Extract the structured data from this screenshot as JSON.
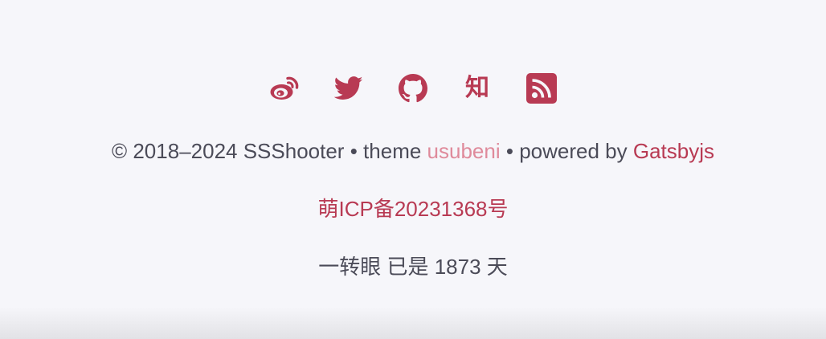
{
  "colors": {
    "accent": "#b83a53",
    "theme_link": "#df8a9b",
    "text": "#4b4b58",
    "background": "#f6f6fa"
  },
  "social": [
    {
      "name": "weibo",
      "icon": "weibo-icon"
    },
    {
      "name": "twitter",
      "icon": "twitter-icon"
    },
    {
      "name": "github",
      "icon": "github-icon"
    },
    {
      "name": "zhihu",
      "icon": "zhihu-icon",
      "glyph": "知"
    },
    {
      "name": "rss",
      "icon": "rss-icon"
    }
  ],
  "footer": {
    "copyright": "© 2018–2024 SSShooter",
    "bullet": "•",
    "theme_prefix": "theme",
    "theme_name": "usubeni",
    "powered_prefix": "powered by",
    "powered_name": "Gatsbyjs",
    "icp": "萌ICP备20231368号",
    "days_prefix": "一转眼 已是",
    "days_count": "1873",
    "days_suffix": "天"
  }
}
